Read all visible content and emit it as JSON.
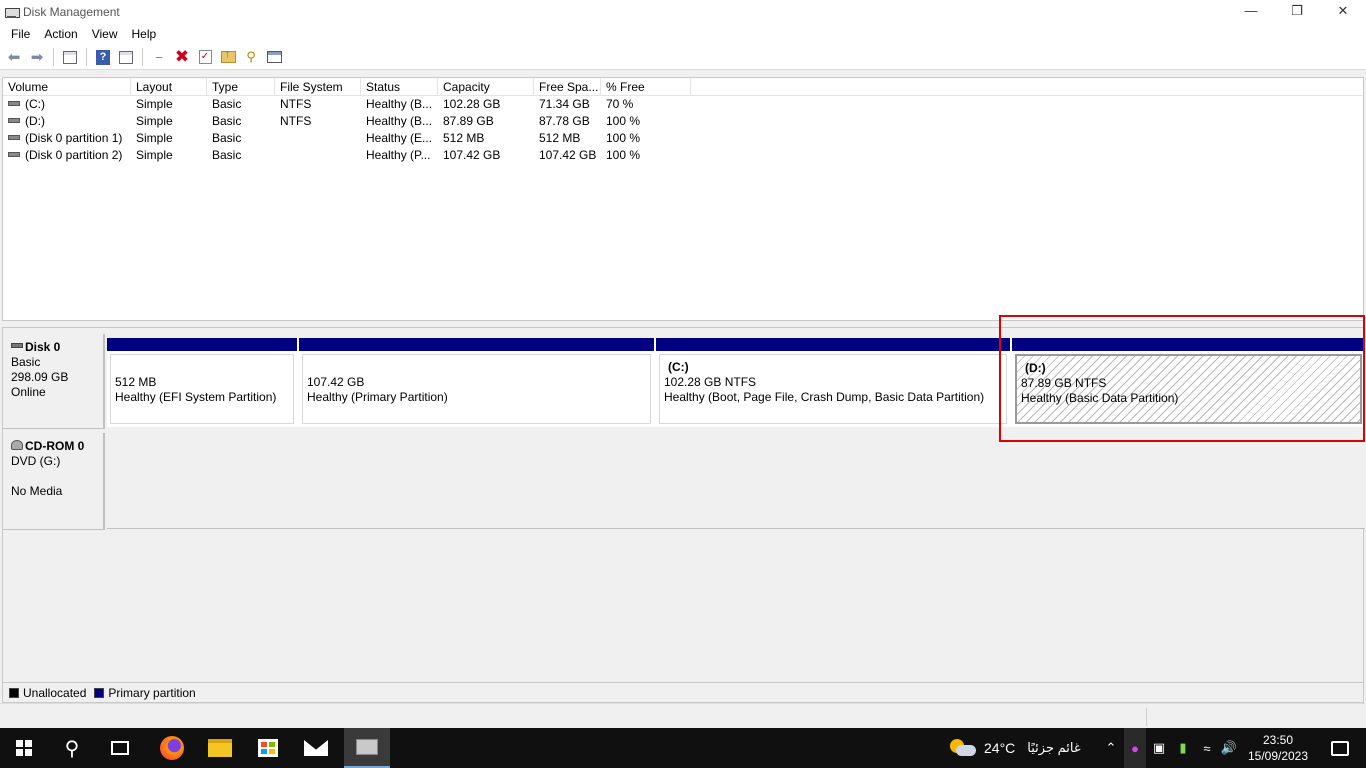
{
  "window": {
    "title": "Disk Management",
    "controls": {
      "minimize": "—",
      "restore": "❐",
      "close": "✕"
    }
  },
  "menu": {
    "items": [
      "File",
      "Action",
      "View",
      "Help"
    ]
  },
  "toolbar": {
    "icons": [
      "back-arrow-icon",
      "forward-arrow-icon",
      "properties-icon",
      "help-icon",
      "show-hide-icon",
      "connect-disk-icon",
      "delete-icon",
      "check-icon",
      "up-folder-icon",
      "search-key-icon",
      "window-icon"
    ]
  },
  "volume_list": {
    "columns": [
      "Volume",
      "Layout",
      "Type",
      "File System",
      "Status",
      "Capacity",
      "Free Spa...",
      "% Free"
    ],
    "rows": [
      {
        "volume": "(C:)",
        "layout": "Simple",
        "type": "Basic",
        "fs": "NTFS",
        "status": "Healthy (B...",
        "capacity": "102.28 GB",
        "free": "71.34 GB",
        "pct": "70 %"
      },
      {
        "volume": "(D:)",
        "layout": "Simple",
        "type": "Basic",
        "fs": "NTFS",
        "status": "Healthy (B...",
        "capacity": "87.89 GB",
        "free": "87.78 GB",
        "pct": "100 %"
      },
      {
        "volume": "(Disk 0 partition 1)",
        "layout": "Simple",
        "type": "Basic",
        "fs": "",
        "status": "Healthy (E...",
        "capacity": "512 MB",
        "free": "512 MB",
        "pct": "100 %"
      },
      {
        "volume": "(Disk 0 partition 2)",
        "layout": "Simple",
        "type": "Basic",
        "fs": "",
        "status": "Healthy (P...",
        "capacity": "107.42 GB",
        "free": "107.42 GB",
        "pct": "100 %"
      }
    ]
  },
  "disk0": {
    "name": "Disk 0",
    "type": "Basic",
    "size": "298.09 GB",
    "state": "Online",
    "partitions": [
      {
        "title": "",
        "size": "512 MB",
        "status": "Healthy (EFI System Partition)"
      },
      {
        "title": "",
        "size": "107.42 GB",
        "status": "Healthy (Primary Partition)"
      },
      {
        "title": "(C:)",
        "size": "102.28 GB NTFS",
        "status": "Healthy (Boot, Page File, Crash Dump, Basic Data Partition)"
      },
      {
        "title": "(D:)",
        "size": "87.89 GB NTFS",
        "status": "Healthy (Basic Data Partition)"
      }
    ]
  },
  "cdrom0": {
    "name": "CD-ROM 0",
    "drive": "DVD (G:)",
    "media": "No Media"
  },
  "legend": {
    "unallocated": "Unallocated",
    "primary": "Primary partition",
    "colors": {
      "unallocated": "#000000",
      "primary": "#000080"
    }
  },
  "taskbar": {
    "weather_temp": "24°C",
    "weather_desc": "غائم جزئيًا",
    "time": "23:50",
    "date": "15/09/2023"
  }
}
